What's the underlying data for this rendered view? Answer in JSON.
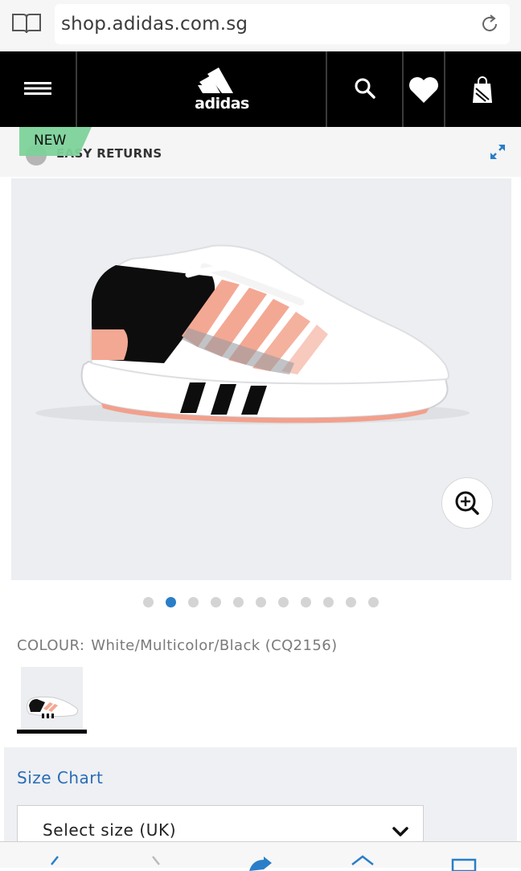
{
  "browser": {
    "url": "shop.adidas.com.sg"
  },
  "nav": {
    "logo_text": "adidas"
  },
  "banner": {
    "badge": "NEW",
    "text": "EASY RETURNS"
  },
  "product": {
    "image_alt": "sneaker",
    "carousel": {
      "count": 11,
      "active_index": 1
    }
  },
  "colour": {
    "label": "COLOUR:",
    "value": "White/Multicolor/Black (CQ2156)"
  },
  "size": {
    "chart_link": "Size Chart",
    "select_placeholder": "Select size (UK)"
  },
  "colors": {
    "nav_bg": "#000000",
    "link": "#2a6db5",
    "dot_active": "#2a7ec8",
    "badge": "#7ed29a",
    "shoe_accent": "#f2a08c"
  }
}
